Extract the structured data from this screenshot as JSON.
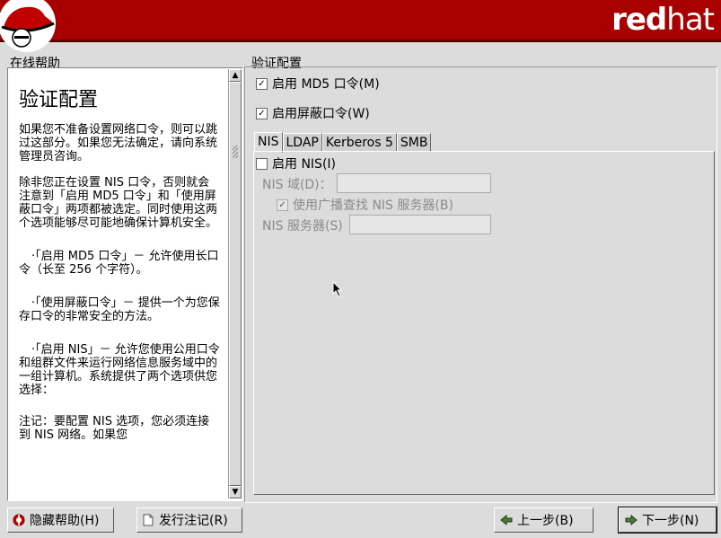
{
  "brand": {
    "red": "red",
    "hat": "hat"
  },
  "help": {
    "panel_title": "在线帮助",
    "heading": "验证配置",
    "para1": "如果您不准备设置网络口令，则可以跳过这部分。如果您无法确定，请向系统管理员咨询。",
    "para2": "除非您正在设置 NIS 口令，否则就会注意到「启用 MD5 口令」和「使用屏蔽口令」两项都被选定。同时使用这两个选项能够尽可能地确保计算机安全。",
    "bullet1": "·「启用 MD5 口令」－ 允许使用长口令（长至 256 个字符）。",
    "bullet2": "·「使用屏蔽口令」－ 提供一个为您保存口令的非常安全的方法。",
    "bullet3": "·「启用 NIS」－ 允许您使用公用口令和组群文件来运行网络信息服务域中的一组计算机。系统提供了两个选项供您选择：",
    "para3": "注记：要配置 NIS 选项，您必须连接到 NIS 网络。如果您"
  },
  "section": {
    "title": "验证配置",
    "md5_label": "启用 MD5 口令(M)",
    "md5_checked": true,
    "shadow_label": "启用屏蔽口令(W)",
    "shadow_checked": true
  },
  "tabs": [
    "NIS",
    "LDAP",
    "Kerberos 5",
    "SMB"
  ],
  "nis": {
    "enable_label": "启用 NIS(I)",
    "enable_checked": false,
    "domain_label": "NIS 域(D)：",
    "domain_value": "",
    "broadcast_label": "使用广播查找 NIS 服务器(B)",
    "broadcast_checked": true,
    "server_label": "NIS 服务器(S)",
    "server_value": ""
  },
  "buttons": {
    "hide_help": "隐藏帮助(H)",
    "release_notes": "发行注记(R)",
    "back": "上一步(B)",
    "next": "下一步(N)"
  }
}
